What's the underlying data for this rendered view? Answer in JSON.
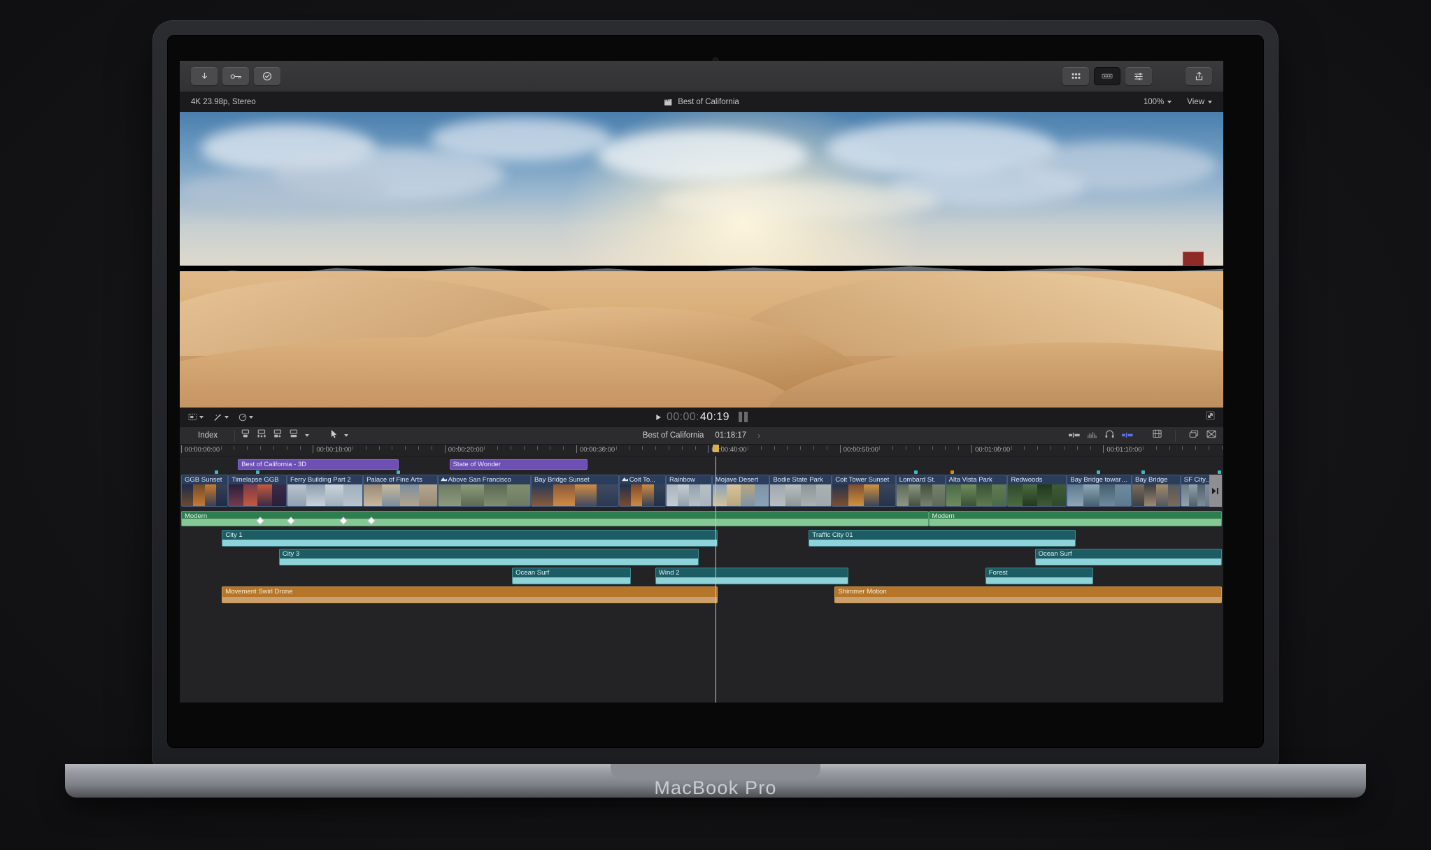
{
  "device": {
    "brand": "MacBook Pro"
  },
  "app": {
    "toolbar": {
      "left_buttons": [
        {
          "name": "import-media-button",
          "icon": "download-arrow-icon"
        },
        {
          "name": "keyword-button",
          "icon": "key-icon"
        },
        {
          "name": "rating-button",
          "icon": "checkmark-circle-icon"
        }
      ],
      "right_buttons": [
        {
          "name": "browser-button",
          "icon": "grid-icon"
        },
        {
          "name": "viewer-button",
          "icon": "filmstrip-icon"
        },
        {
          "name": "inspector-button",
          "icon": "sliders-icon"
        },
        {
          "name": "share-button",
          "icon": "share-export-icon"
        }
      ]
    },
    "infobar": {
      "format": "4K 23.98p, Stereo",
      "project_title": "Best of California",
      "project_icon": "clapperboard-icon",
      "zoom": "100%",
      "view_menu": "View"
    },
    "transport": {
      "timecode_dim": "00:00:",
      "timecode_bright": "40:19",
      "play_icon": "play-triangle-icon",
      "left_tools": [
        "show-hide-icon",
        "effects-wand-icon",
        "speed-gauge-icon"
      ],
      "fullscreen_icon": "expand-arrows-icon"
    },
    "indexbar": {
      "index_label": "Index",
      "tools": [
        "append-edit-icon",
        "insert-edit-icon",
        "overwrite-edit-icon",
        "connect-edit-icon"
      ],
      "selection_tool": "arrow-select-icon",
      "project_name": "Best of California",
      "project_duration": "01:18:17",
      "right_icons": [
        "clip-appearance-icon",
        "audio-meter-icon",
        "headphone-icon",
        "skimming-icon",
        "filmstrip-view-icon",
        "clip-height-icon",
        "hide-index-icon"
      ]
    },
    "timeline": {
      "ruler_labels": [
        {
          "text": "00:00:00:00",
          "pct": 0.0
        },
        {
          "text": "00:00:10:00",
          "pct": 0.1266
        },
        {
          "text": "00:00:20:00",
          "pct": 0.2532
        },
        {
          "text": "00:00:30:00",
          "pct": 0.3797
        },
        {
          "text": "00:00:40:00",
          "pct": 0.5063
        },
        {
          "text": "00:00:50:00",
          "pct": 0.6329
        },
        {
          "text": "00:01:00:00",
          "pct": 0.7595
        },
        {
          "text": "00:01:10:00",
          "pct": 0.886
        }
      ],
      "playhead_pct": 0.5133,
      "titles": [
        {
          "label": "Best of California - 3D",
          "left_pct": 0.0545,
          "width_pct": 0.1548
        },
        {
          "label": "State of Wonder",
          "left_pct": 0.2578,
          "width_pct": 0.1326
        }
      ],
      "video_clips": [
        {
          "label": "GGB Sunset",
          "left_pct": 0.0,
          "width_pct": 0.0452,
          "icon": ""
        },
        {
          "label": "Timelapse GGB",
          "left_pct": 0.0452,
          "width_pct": 0.0563,
          "icon": ""
        },
        {
          "label": "Ferry Building Part 2",
          "left_pct": 0.1015,
          "width_pct": 0.0733,
          "icon": ""
        },
        {
          "label": "Palace of Fine Arts",
          "left_pct": 0.1748,
          "width_pct": 0.0716,
          "icon": ""
        },
        {
          "label": "Above San Francisco",
          "left_pct": 0.2464,
          "width_pct": 0.0896,
          "icon": "retime-icon"
        },
        {
          "label": "Bay Bridge Sunset",
          "left_pct": 0.336,
          "width_pct": 0.0845,
          "icon": ""
        },
        {
          "label": "Coit To...",
          "left_pct": 0.4205,
          "width_pct": 0.0452,
          "icon": "retime-icon"
        },
        {
          "label": "Rainbow",
          "left_pct": 0.4657,
          "width_pct": 0.0443,
          "icon": ""
        },
        {
          "label": "Mojave Desert",
          "left_pct": 0.51,
          "width_pct": 0.0555,
          "icon": ""
        },
        {
          "label": "Bodie State Park",
          "left_pct": 0.5655,
          "width_pct": 0.0597,
          "icon": ""
        },
        {
          "label": "Coit Tower Sunset",
          "left_pct": 0.6252,
          "width_pct": 0.0614,
          "icon": ""
        },
        {
          "label": "Lombard St.",
          "left_pct": 0.6866,
          "width_pct": 0.0477,
          "icon": ""
        },
        {
          "label": "Alta Vista Park",
          "left_pct": 0.7343,
          "width_pct": 0.0597,
          "icon": ""
        },
        {
          "label": "Redwoods",
          "left_pct": 0.794,
          "width_pct": 0.0571,
          "icon": ""
        },
        {
          "label": "Bay Bridge toward SF",
          "left_pct": 0.8511,
          "width_pct": 0.0622,
          "icon": ""
        },
        {
          "label": "Bay Bridge",
          "left_pct": 0.9133,
          "width_pct": 0.0469,
          "icon": ""
        },
        {
          "label": "SF City...",
          "left_pct": 0.9602,
          "width_pct": 0.0322,
          "icon": ""
        }
      ],
      "music_clips": [
        {
          "label": "Modern",
          "left_pct": 0.0,
          "width_pct": 0.7181
        },
        {
          "label": "Modern",
          "left_pct": 0.7181,
          "width_pct": 0.2819
        }
      ],
      "audio_lane_1": [
        {
          "label": "City 1",
          "left_pct": 0.0392,
          "width_pct": 0.476
        },
        {
          "label": "Traffic City 01",
          "left_pct": 0.6031,
          "width_pct": 0.2565
        }
      ],
      "audio_lane_2": [
        {
          "label": "City 3",
          "left_pct": 0.094,
          "width_pct": 0.4034
        },
        {
          "label": "Ocean Surf",
          "left_pct": 0.8203,
          "width_pct": 0.1797
        }
      ],
      "audio_lane_3": [
        {
          "label": "Ocean Surf",
          "left_pct": 0.318,
          "width_pct": 0.1138
        },
        {
          "label": "Wind 2",
          "left_pct": 0.4556,
          "width_pct": 0.1856
        },
        {
          "label": "Forest",
          "left_pct": 0.7727,
          "width_pct": 0.1035
        }
      ],
      "effect_clips": [
        {
          "label": "Movement Swirl Drone",
          "left_pct": 0.0392,
          "width_pct": 0.476
        },
        {
          "label": "Shimmer Motion",
          "left_pct": 0.628,
          "width_pct": 0.372
        }
      ],
      "keyframes_pct": [
        0.0735,
        0.1027,
        0.153,
        0.18
      ],
      "markers": [
        {
          "pct": 0.032,
          "color": "#3fb9c6"
        },
        {
          "pct": 0.072,
          "color": "#3fb9c6"
        },
        {
          "pct": 0.207,
          "color": "#3fb9c6"
        },
        {
          "pct": 0.704,
          "color": "#3fb9c6"
        },
        {
          "pct": 0.739,
          "color": "#e0881f"
        },
        {
          "pct": 0.88,
          "color": "#3fb9c6"
        },
        {
          "pct": 0.923,
          "color": "#3fb9c6"
        },
        {
          "pct": 0.996,
          "color": "#3fb9c6"
        }
      ]
    }
  }
}
